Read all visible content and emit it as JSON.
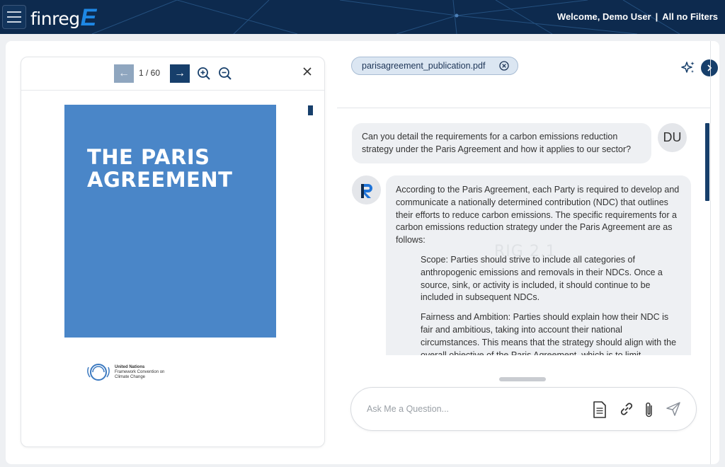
{
  "header": {
    "logo_text": "finreg",
    "logo_mark": "E",
    "welcome": "Welcome, Demo User",
    "separator": "|",
    "filters": "All no Filters"
  },
  "pdf_viewer": {
    "page_indicator": "1 / 60",
    "prev_label": "←",
    "next_label": "→",
    "cover_title": "THE PARIS AGREEMENT",
    "publisher_line1": "United Nations",
    "publisher_line2": "Framework Convention on",
    "publisher_line3": "Climate Change"
  },
  "chat": {
    "file_chip": "parisagreement_publication.pdf",
    "user_avatar": "DU",
    "user_message": "Can you detail the requirements for a carbon emissions reduction strategy under the Paris Agreement and how it applies to our sector?",
    "bot_intro": "According to the Paris Agreement, each Party is required to develop and communicate a nationally determined contribution (NDC) that outlines their efforts to reduce carbon emissions. The specific requirements for a carbon emissions reduction strategy under the Paris Agreement are as follows:",
    "bot_items": [
      "Scope: Parties should strive to include all categories of anthropogenic emissions and removals in their NDCs. Once a source, sink, or activity is included, it should continue to be included in subsequent NDCs.",
      "Fairness and Ambition: Parties should explain how their NDC is fair and ambitious, taking into account their national circumstances. This means that the strategy should align with the overall objective of the Paris Agreement, which is to limit"
    ],
    "watermark": "RIG 2.1",
    "input_placeholder": "Ask Me a Question..."
  },
  "colors": {
    "header_bg": "#0d2a4e",
    "accent": "#173f6b",
    "cover_blue": "#4a86c8",
    "logo_e": "#1e88e5"
  }
}
